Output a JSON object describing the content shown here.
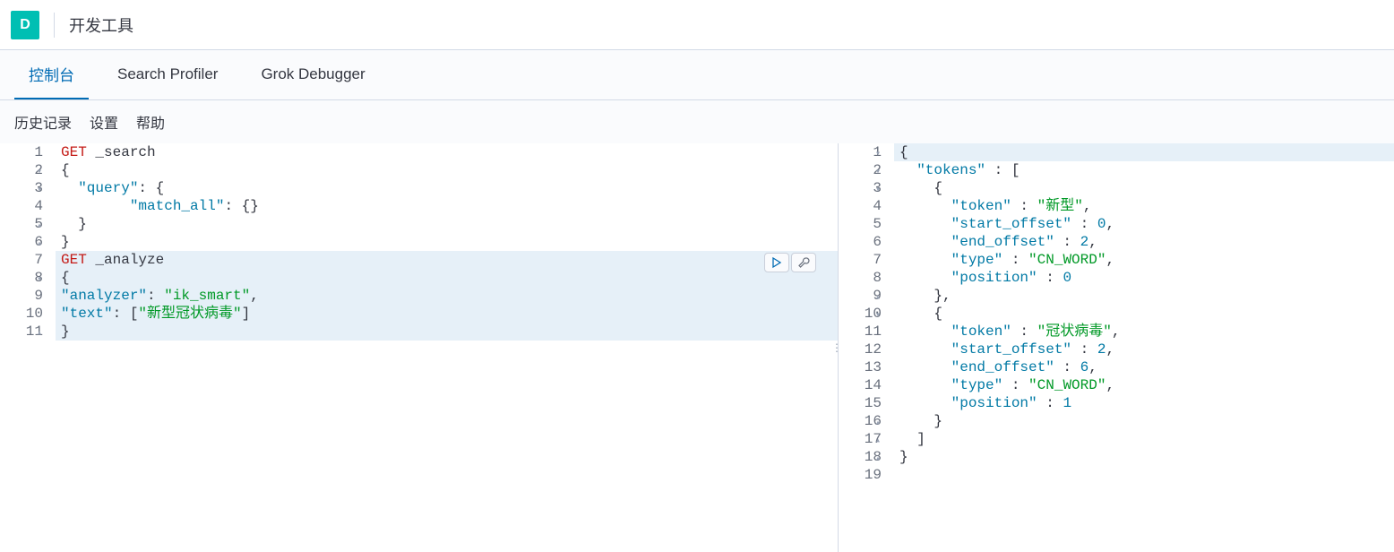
{
  "header": {
    "logo_letter": "D",
    "title": "开发工具"
  },
  "tabs": [
    {
      "label": "控制台",
      "active": true
    },
    {
      "label": "Search Profiler",
      "active": false
    },
    {
      "label": "Grok Debugger",
      "active": false
    }
  ],
  "subnav": {
    "history": "历史记录",
    "settings": "设置",
    "help": "帮助"
  },
  "editor": {
    "gutter": [
      "1",
      "2",
      "3",
      "4",
      "5",
      "6",
      "7",
      "8",
      "9",
      "10",
      "11"
    ],
    "fold_markers": {
      "2": "▾",
      "3": "▾",
      "5": "▴",
      "6": "▴",
      "8": "▾",
      "11": "▴"
    },
    "lines": [
      {
        "tokens": [
          {
            "t": "GET",
            "c": "keyword"
          },
          {
            "t": " _search",
            "c": "path"
          }
        ],
        "active": false
      },
      {
        "tokens": [
          {
            "t": "{",
            "c": "punct"
          }
        ],
        "active": false
      },
      {
        "tokens": [
          {
            "t": "  ",
            "c": "punct"
          },
          {
            "t": "\"query\"",
            "c": "prop"
          },
          {
            "t": ": {",
            "c": "punct"
          }
        ],
        "active": false
      },
      {
        "tokens": [
          {
            "t": "    ",
            "c": "punct"
          },
          {
            "t": "\"match_all\"",
            "c": "prop"
          },
          {
            "t": ": {}",
            "c": "punct"
          }
        ],
        "active": false,
        "indent": true
      },
      {
        "tokens": [
          {
            "t": "  }",
            "c": "punct"
          }
        ],
        "active": false
      },
      {
        "tokens": [
          {
            "t": "}",
            "c": "punct"
          }
        ],
        "active": false
      },
      {
        "tokens": [
          {
            "t": "GET",
            "c": "keyword"
          },
          {
            "t": " _analyze",
            "c": "path"
          }
        ],
        "active": true
      },
      {
        "tokens": [
          {
            "t": "{",
            "c": "punct"
          }
        ],
        "active": true
      },
      {
        "tokens": [
          {
            "t": "\"analyzer\"",
            "c": "prop"
          },
          {
            "t": ": ",
            "c": "punct"
          },
          {
            "t": "\"ik_smart\"",
            "c": "string"
          },
          {
            "t": ",",
            "c": "punct"
          }
        ],
        "active": true
      },
      {
        "tokens": [
          {
            "t": "\"text\"",
            "c": "prop"
          },
          {
            "t": ": [",
            "c": "punct"
          },
          {
            "t": "\"新型冠状病毒\"",
            "c": "string"
          },
          {
            "t": "]",
            "c": "punct"
          }
        ],
        "active": true
      },
      {
        "tokens": [
          {
            "t": "}",
            "c": "punct"
          }
        ],
        "active": true
      }
    ]
  },
  "output": {
    "gutter": [
      "1",
      "2",
      "3",
      "4",
      "5",
      "6",
      "7",
      "8",
      "9",
      "10",
      "11",
      "12",
      "13",
      "14",
      "15",
      "16",
      "17",
      "18",
      "19"
    ],
    "fold_markers": {
      "1": "▾",
      "2": "▾",
      "3": "▾",
      "9": "▴",
      "10": "▾",
      "16": "▴",
      "17": "▴",
      "18": "▴"
    },
    "lines": [
      {
        "tokens": [
          {
            "t": "{",
            "c": "punct"
          }
        ],
        "hl": true
      },
      {
        "tokens": [
          {
            "t": "  ",
            "c": "punct"
          },
          {
            "t": "\"tokens\"",
            "c": "prop"
          },
          {
            "t": " : [",
            "c": "punct"
          }
        ]
      },
      {
        "tokens": [
          {
            "t": "    {",
            "c": "punct"
          }
        ]
      },
      {
        "tokens": [
          {
            "t": "      ",
            "c": "punct"
          },
          {
            "t": "\"token\"",
            "c": "prop"
          },
          {
            "t": " : ",
            "c": "punct"
          },
          {
            "t": "\"新型\"",
            "c": "string"
          },
          {
            "t": ",",
            "c": "punct"
          }
        ]
      },
      {
        "tokens": [
          {
            "t": "      ",
            "c": "punct"
          },
          {
            "t": "\"start_offset\"",
            "c": "prop"
          },
          {
            "t": " : ",
            "c": "punct"
          },
          {
            "t": "0",
            "c": "number"
          },
          {
            "t": ",",
            "c": "punct"
          }
        ]
      },
      {
        "tokens": [
          {
            "t": "      ",
            "c": "punct"
          },
          {
            "t": "\"end_offset\"",
            "c": "prop"
          },
          {
            "t": " : ",
            "c": "punct"
          },
          {
            "t": "2",
            "c": "number"
          },
          {
            "t": ",",
            "c": "punct"
          }
        ]
      },
      {
        "tokens": [
          {
            "t": "      ",
            "c": "punct"
          },
          {
            "t": "\"type\"",
            "c": "prop"
          },
          {
            "t": " : ",
            "c": "punct"
          },
          {
            "t": "\"CN_WORD\"",
            "c": "string"
          },
          {
            "t": ",",
            "c": "punct"
          }
        ]
      },
      {
        "tokens": [
          {
            "t": "      ",
            "c": "punct"
          },
          {
            "t": "\"position\"",
            "c": "prop"
          },
          {
            "t": " : ",
            "c": "punct"
          },
          {
            "t": "0",
            "c": "number"
          }
        ]
      },
      {
        "tokens": [
          {
            "t": "    },",
            "c": "punct"
          }
        ]
      },
      {
        "tokens": [
          {
            "t": "    {",
            "c": "punct"
          }
        ]
      },
      {
        "tokens": [
          {
            "t": "      ",
            "c": "punct"
          },
          {
            "t": "\"token\"",
            "c": "prop"
          },
          {
            "t": " : ",
            "c": "punct"
          },
          {
            "t": "\"冠状病毒\"",
            "c": "string"
          },
          {
            "t": ",",
            "c": "punct"
          }
        ]
      },
      {
        "tokens": [
          {
            "t": "      ",
            "c": "punct"
          },
          {
            "t": "\"start_offset\"",
            "c": "prop"
          },
          {
            "t": " : ",
            "c": "punct"
          },
          {
            "t": "2",
            "c": "number"
          },
          {
            "t": ",",
            "c": "punct"
          }
        ]
      },
      {
        "tokens": [
          {
            "t": "      ",
            "c": "punct"
          },
          {
            "t": "\"end_offset\"",
            "c": "prop"
          },
          {
            "t": " : ",
            "c": "punct"
          },
          {
            "t": "6",
            "c": "number"
          },
          {
            "t": ",",
            "c": "punct"
          }
        ]
      },
      {
        "tokens": [
          {
            "t": "      ",
            "c": "punct"
          },
          {
            "t": "\"type\"",
            "c": "prop"
          },
          {
            "t": " : ",
            "c": "punct"
          },
          {
            "t": "\"CN_WORD\"",
            "c": "string"
          },
          {
            "t": ",",
            "c": "punct"
          }
        ]
      },
      {
        "tokens": [
          {
            "t": "      ",
            "c": "punct"
          },
          {
            "t": "\"position\"",
            "c": "prop"
          },
          {
            "t": " : ",
            "c": "punct"
          },
          {
            "t": "1",
            "c": "number"
          }
        ]
      },
      {
        "tokens": [
          {
            "t": "    }",
            "c": "punct"
          }
        ]
      },
      {
        "tokens": [
          {
            "t": "  ]",
            "c": "punct"
          }
        ]
      },
      {
        "tokens": [
          {
            "t": "}",
            "c": "punct"
          }
        ]
      },
      {
        "tokens": []
      }
    ]
  }
}
